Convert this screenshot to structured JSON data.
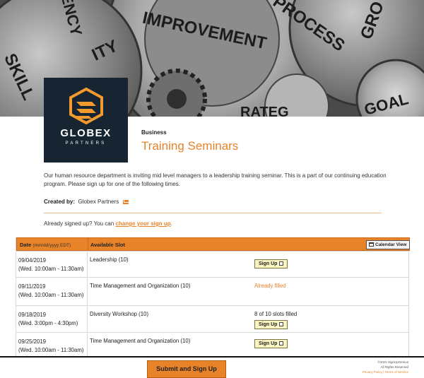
{
  "banner": {
    "words": [
      "ENCY",
      "ITY",
      "IMPROVEMENT",
      "PROCESS",
      "GRO",
      "SKILL",
      "GOAL",
      "RATEG"
    ]
  },
  "logo": {
    "name": "GLOBEX",
    "sub": "PARTNERS"
  },
  "header": {
    "category": "Business",
    "title": "Training Seminars"
  },
  "description": "Our human resource department is inviting mid level managers to a leadership training seminar.  This is a part of our continuing education program.  Please sign up for one of the following times.",
  "created": {
    "label": "Created by:",
    "name": "Globex Partners"
  },
  "already": {
    "prefix": "Already signed up? You can ",
    "link": "change your sign up",
    "suffix": "."
  },
  "table": {
    "date_header": "Date",
    "date_hint": "(mm/dd/yyyy EDT)",
    "slot_header": "Available Slot",
    "calendar_button": "Calendar View",
    "rows": [
      {
        "date": "09/04/2019",
        "time": "(Wed. 10:00am - 11:30am)",
        "slot": "Leadership (10)",
        "status": "",
        "button": "Sign Up"
      },
      {
        "date": "09/11/2019",
        "time": "(Wed. 10:00am - 11:30am)",
        "slot": "Time Management and Organization (10)",
        "status": "Already filled",
        "button": ""
      },
      {
        "date": "09/18/2019",
        "time": "(Wed. 3:00pm - 4:30pm)",
        "slot": "Diversity Workshop (10)",
        "status": "8 of 10 slots filled",
        "button": "Sign Up"
      },
      {
        "date": "09/25/2019",
        "time": "(Wed. 10:00am - 11:30am)",
        "slot": "Time Management and Organization (10)",
        "status": "",
        "button": "Sign Up"
      }
    ]
  },
  "footer": {
    "submit": "Submit and Sign Up",
    "copyright": "©2021 SignUpGenius",
    "rights": "All Rights Reserved",
    "links": "Privacy Policy | Terms of Service"
  },
  "colors": {
    "accent": "#e8832a",
    "logo_bg": "#162531",
    "button_bg": "#fbf5c2"
  }
}
